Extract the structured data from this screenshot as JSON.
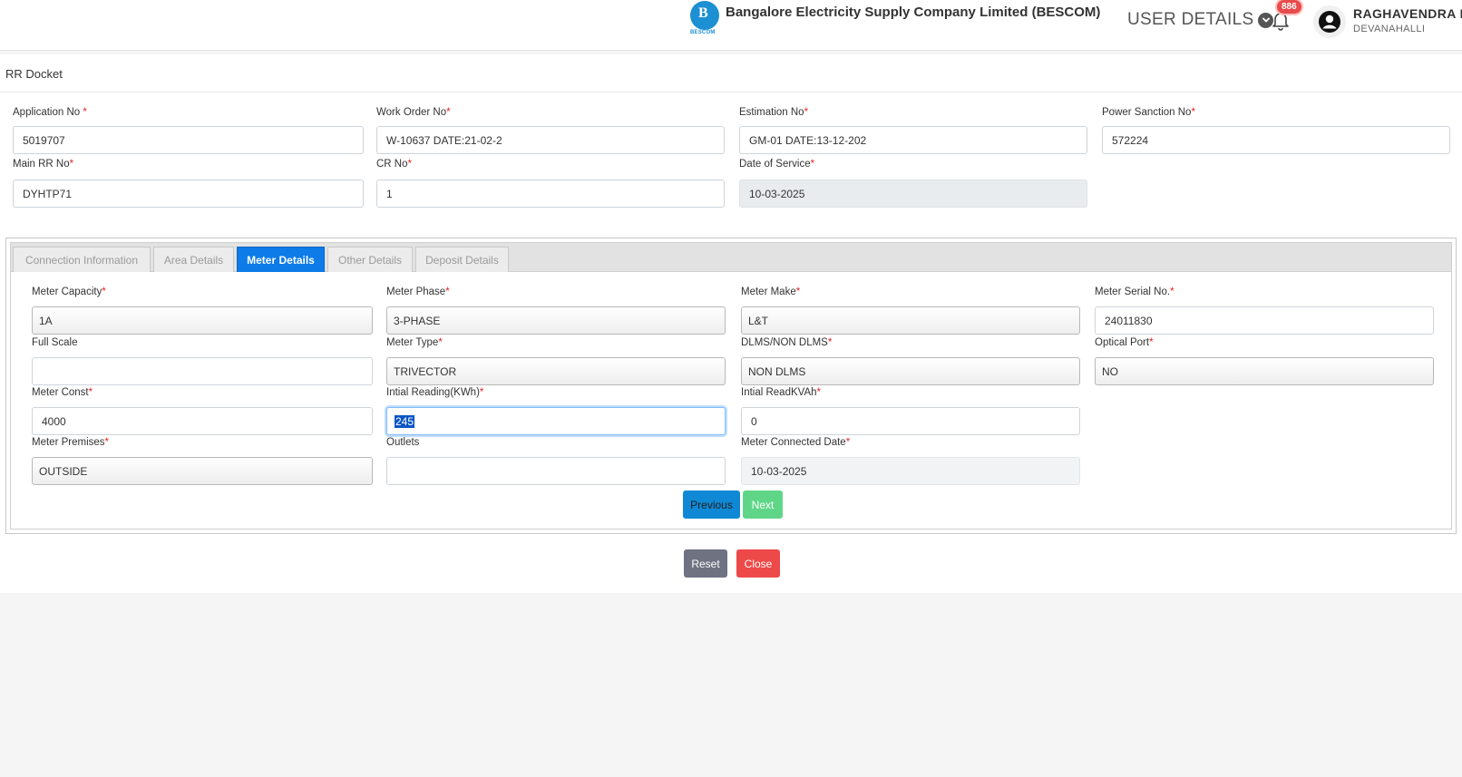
{
  "header": {
    "logo_text": "BESCOM",
    "logo_letter": "B",
    "company_name": "Bangalore Electricity Supply Company Limited (BESCOM)",
    "user_details_label": "USER DETAILS",
    "notification_count": "886",
    "user_name": "RAGHAVENDRA PRASAD",
    "user_location": "DEVANAHALLI"
  },
  "page": {
    "title": "RR Docket"
  },
  "docket": {
    "application_no": {
      "label": "Application No",
      "required": "*",
      "value": "5019707"
    },
    "work_order_no": {
      "label": "Work Order No",
      "required": "*",
      "value": "W-10637 DATE:21-02-2"
    },
    "estimation_no": {
      "label": "Estimation No",
      "required": "*",
      "value": "GM-01 DATE:13-12-202"
    },
    "power_sanction_no": {
      "label": "Power Sanction No",
      "required": "*",
      "value": "572224"
    },
    "main_rr_no": {
      "label": "Main RR No",
      "required": "*",
      "value": "DYHTP71"
    },
    "cr_no": {
      "label": "CR No",
      "required": "*",
      "value": "1"
    },
    "date_of_service": {
      "label": "Date of Service",
      "required": "*",
      "value": "10-03-2025"
    }
  },
  "tabs": [
    {
      "label": "Connection Information"
    },
    {
      "label": "Area Details"
    },
    {
      "label": "Meter Details"
    },
    {
      "label": "Other Details"
    },
    {
      "label": "Deposit Details"
    }
  ],
  "meter": {
    "capacity": {
      "label": "Meter Capacity",
      "required": "*",
      "value": "1A"
    },
    "phase": {
      "label": "Meter Phase",
      "required": "*",
      "value": "3-PHASE"
    },
    "make": {
      "label": "Meter Make",
      "required": "*",
      "value": "L&T"
    },
    "serial_no": {
      "label": "Meter Serial No.",
      "required": "*",
      "value": "24011830"
    },
    "full_scale": {
      "label": "Full Scale",
      "value": ""
    },
    "type": {
      "label": "Meter Type",
      "required": "*",
      "value": "TRIVECTOR"
    },
    "dlms": {
      "label": "DLMS/NON DLMS",
      "required": "*",
      "value": "NON DLMS"
    },
    "optical_port": {
      "label": "Optical Port",
      "required": "*",
      "value": "NO"
    },
    "const": {
      "label": "Meter Const",
      "required": "*",
      "value": "4000"
    },
    "initial_kwh": {
      "label": "Intial Reading(KWh)",
      "required": "*",
      "value": "245"
    },
    "initial_kvah": {
      "label": "Intial ReadKVAh",
      "required": "*",
      "value": "0"
    },
    "premises": {
      "label": "Meter Premises",
      "required": "*",
      "value": "OUTSIDE"
    },
    "outlets": {
      "label": "Outlets",
      "value": ""
    },
    "connected_date": {
      "label": "Meter Connected Date",
      "required": "*",
      "value": "10-03-2025"
    }
  },
  "buttons": {
    "previous": "Previous",
    "next": "Next",
    "reset": "Reset",
    "close": "Close"
  },
  "colors": {
    "active_tab": "#0d7be8",
    "previous": "#0f88d5",
    "next": "#5fd687",
    "reset": "#6e7281",
    "close": "#ee4949",
    "required": "#e02424"
  }
}
